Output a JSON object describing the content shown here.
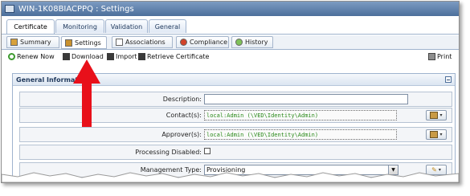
{
  "window": {
    "title": "WIN-1K08BIACPPQ : Settings"
  },
  "primary_tabs": [
    {
      "label": "Certificate",
      "active": true
    },
    {
      "label": "Monitoring",
      "active": false
    },
    {
      "label": "Validation",
      "active": false
    },
    {
      "label": "General",
      "active": false
    }
  ],
  "secondary_tabs": [
    {
      "label": "Summary",
      "icon": "summary-icon",
      "active": false
    },
    {
      "label": "Settings",
      "icon": "settings-icon",
      "active": true
    },
    {
      "label": "Associations",
      "icon": "associations-icon",
      "active": false
    },
    {
      "label": "Compliance",
      "icon": "compliance-icon",
      "active": false
    },
    {
      "label": "History",
      "icon": "history-icon",
      "active": false
    }
  ],
  "toolbar": {
    "renew": "Renew Now",
    "download": "Download",
    "import": "Import",
    "retrieve": "Retrieve Certificate",
    "print": "Print"
  },
  "section": {
    "title": "General Information",
    "fields": {
      "description_label": "Description:",
      "description_value": "",
      "contacts_label": "Contact(s):",
      "contacts_value": "local:Admin (\\VED\\Identity\\Admin)",
      "approvers_label": "Approver(s):",
      "approvers_value": "local:Admin (\\VED\\Identity\\Admin)",
      "processing_disabled_label": "Processing Disabled:",
      "processing_disabled_checked": false,
      "management_type_label": "Management Type:",
      "management_type_value": "Provisioning"
    }
  },
  "colors": {
    "title_bar": "#4c6f9b",
    "identity_text": "#2a8a1a",
    "annotation_arrow": "#e8101a"
  }
}
